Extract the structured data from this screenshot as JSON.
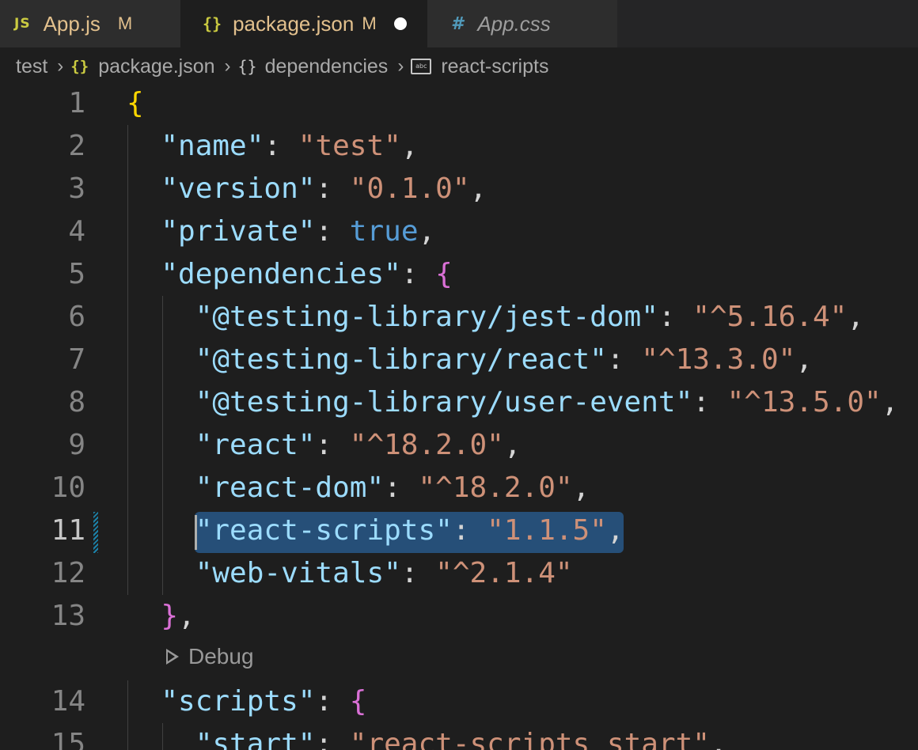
{
  "tabs": [
    {
      "icon": "JS",
      "label": "App.js",
      "status": "M"
    },
    {
      "icon": "{}",
      "label": "package.json",
      "status": "M"
    },
    {
      "icon": "#",
      "label": "App.css"
    }
  ],
  "breadcrumb": [
    "test",
    "package.json",
    "dependencies",
    "react-scripts"
  ],
  "code_lens": "Debug",
  "colors": {
    "key": "#9cdcfe",
    "string": "#ce9178",
    "boolean": "#569cd6",
    "bracket_level1": "#ffd700",
    "bracket_level2": "#da70d6",
    "selection": "#264f78"
  },
  "lines": [
    {
      "n": "1",
      "tokens": [
        {
          "t": "{",
          "c": "br1"
        }
      ]
    },
    {
      "n": "2",
      "tokens": [
        {
          "t": "  "
        },
        {
          "t": "\"name\"",
          "c": "k"
        },
        {
          "t": ": "
        },
        {
          "t": "\"test\"",
          "c": "s"
        },
        {
          "t": ","
        }
      ]
    },
    {
      "n": "3",
      "tokens": [
        {
          "t": "  "
        },
        {
          "t": "\"version\"",
          "c": "k"
        },
        {
          "t": ": "
        },
        {
          "t": "\"0.1.0\"",
          "c": "s"
        },
        {
          "t": ","
        }
      ]
    },
    {
      "n": "4",
      "tokens": [
        {
          "t": "  "
        },
        {
          "t": "\"private\"",
          "c": "k"
        },
        {
          "t": ": "
        },
        {
          "t": "true",
          "c": "b"
        },
        {
          "t": ","
        }
      ]
    },
    {
      "n": "5",
      "tokens": [
        {
          "t": "  "
        },
        {
          "t": "\"dependencies\"",
          "c": "k"
        },
        {
          "t": ": "
        },
        {
          "t": "{",
          "c": "br2"
        }
      ]
    },
    {
      "n": "6",
      "tokens": [
        {
          "t": "    "
        },
        {
          "t": "\"@testing-library/jest-dom\"",
          "c": "k"
        },
        {
          "t": ": "
        },
        {
          "t": "\"^5.16.4\"",
          "c": "s"
        },
        {
          "t": ","
        }
      ]
    },
    {
      "n": "7",
      "tokens": [
        {
          "t": "    "
        },
        {
          "t": "\"@testing-library/react\"",
          "c": "k"
        },
        {
          "t": ": "
        },
        {
          "t": "\"^13.3.0\"",
          "c": "s"
        },
        {
          "t": ","
        }
      ]
    },
    {
      "n": "8",
      "tokens": [
        {
          "t": "    "
        },
        {
          "t": "\"@testing-library/user-event\"",
          "c": "k"
        },
        {
          "t": ": "
        },
        {
          "t": "\"^13.5.0\"",
          "c": "s"
        },
        {
          "t": ","
        }
      ]
    },
    {
      "n": "9",
      "tokens": [
        {
          "t": "    "
        },
        {
          "t": "\"react\"",
          "c": "k"
        },
        {
          "t": ": "
        },
        {
          "t": "\"^18.2.0\"",
          "c": "s"
        },
        {
          "t": ","
        }
      ]
    },
    {
      "n": "10",
      "tokens": [
        {
          "t": "    "
        },
        {
          "t": "\"react-dom\"",
          "c": "k"
        },
        {
          "t": ": "
        },
        {
          "t": "\"^18.2.0\"",
          "c": "s"
        },
        {
          "t": ","
        }
      ]
    },
    {
      "n": "11",
      "tokens": [
        {
          "t": "    "
        },
        {
          "t": "\"react-scripts\"",
          "c": "k"
        },
        {
          "t": ": "
        },
        {
          "t": "\"1.1.5\"",
          "c": "s"
        },
        {
          "t": ","
        }
      ]
    },
    {
      "n": "12",
      "tokens": [
        {
          "t": "    "
        },
        {
          "t": "\"web-vitals\"",
          "c": "k"
        },
        {
          "t": ": "
        },
        {
          "t": "\"^2.1.4\"",
          "c": "s"
        }
      ]
    },
    {
      "n": "13",
      "tokens": [
        {
          "t": "  "
        },
        {
          "t": "}",
          "c": "br2"
        },
        {
          "t": ","
        }
      ]
    },
    {
      "n": "14",
      "tokens": [
        {
          "t": "  "
        },
        {
          "t": "\"scripts\"",
          "c": "k"
        },
        {
          "t": ": "
        },
        {
          "t": "{",
          "c": "br2"
        }
      ]
    },
    {
      "n": "15",
      "tokens": [
        {
          "t": "    "
        },
        {
          "t": "\"start\"",
          "c": "k"
        },
        {
          "t": ": "
        },
        {
          "t": "\"react-scripts start\"",
          "c": "s"
        },
        {
          "t": ","
        }
      ]
    }
  ],
  "active_line": "11"
}
